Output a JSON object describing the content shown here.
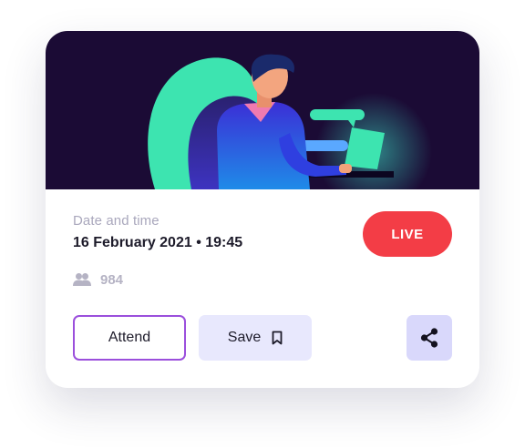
{
  "event": {
    "date_label": "Date and time",
    "date_value": "16 February 2021 • 19:45",
    "status_badge": "LIVE",
    "attendee_count": "984"
  },
  "actions": {
    "attend_label": "Attend",
    "save_label": "Save"
  },
  "icons": {
    "attendees": "people-icon",
    "save": "bookmark-icon",
    "share": "share-icon"
  },
  "colors": {
    "hero_background": "#1b0b35",
    "live_badge": "#f33d46",
    "attend_border": "#9b4fdc",
    "save_background": "#e8e8fd",
    "share_background": "#d9d8fb",
    "illustration_green": "#3de4b0"
  }
}
